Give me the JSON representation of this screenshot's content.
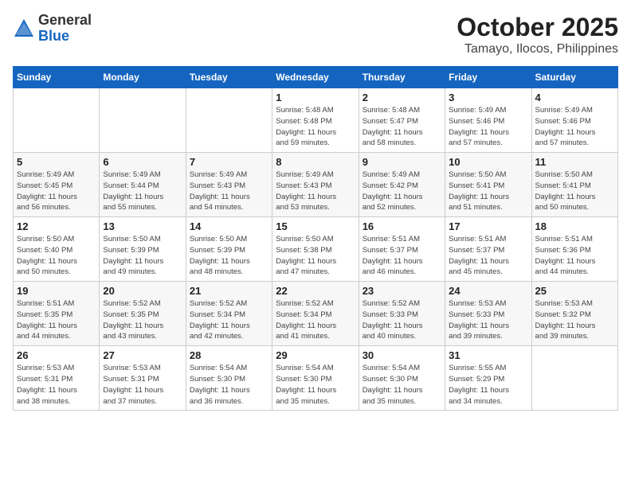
{
  "header": {
    "logo_general": "General",
    "logo_blue": "Blue",
    "month": "October 2025",
    "location": "Tamayo, Ilocos, Philippines"
  },
  "days_of_week": [
    "Sunday",
    "Monday",
    "Tuesday",
    "Wednesday",
    "Thursday",
    "Friday",
    "Saturday"
  ],
  "weeks": [
    [
      {
        "day": "",
        "info": ""
      },
      {
        "day": "",
        "info": ""
      },
      {
        "day": "",
        "info": ""
      },
      {
        "day": "1",
        "info": "Sunrise: 5:48 AM\nSunset: 5:48 PM\nDaylight: 11 hours\nand 59 minutes."
      },
      {
        "day": "2",
        "info": "Sunrise: 5:48 AM\nSunset: 5:47 PM\nDaylight: 11 hours\nand 58 minutes."
      },
      {
        "day": "3",
        "info": "Sunrise: 5:49 AM\nSunset: 5:46 PM\nDaylight: 11 hours\nand 57 minutes."
      },
      {
        "day": "4",
        "info": "Sunrise: 5:49 AM\nSunset: 5:46 PM\nDaylight: 11 hours\nand 57 minutes."
      }
    ],
    [
      {
        "day": "5",
        "info": "Sunrise: 5:49 AM\nSunset: 5:45 PM\nDaylight: 11 hours\nand 56 minutes."
      },
      {
        "day": "6",
        "info": "Sunrise: 5:49 AM\nSunset: 5:44 PM\nDaylight: 11 hours\nand 55 minutes."
      },
      {
        "day": "7",
        "info": "Sunrise: 5:49 AM\nSunset: 5:43 PM\nDaylight: 11 hours\nand 54 minutes."
      },
      {
        "day": "8",
        "info": "Sunrise: 5:49 AM\nSunset: 5:43 PM\nDaylight: 11 hours\nand 53 minutes."
      },
      {
        "day": "9",
        "info": "Sunrise: 5:49 AM\nSunset: 5:42 PM\nDaylight: 11 hours\nand 52 minutes."
      },
      {
        "day": "10",
        "info": "Sunrise: 5:50 AM\nSunset: 5:41 PM\nDaylight: 11 hours\nand 51 minutes."
      },
      {
        "day": "11",
        "info": "Sunrise: 5:50 AM\nSunset: 5:41 PM\nDaylight: 11 hours\nand 50 minutes."
      }
    ],
    [
      {
        "day": "12",
        "info": "Sunrise: 5:50 AM\nSunset: 5:40 PM\nDaylight: 11 hours\nand 50 minutes."
      },
      {
        "day": "13",
        "info": "Sunrise: 5:50 AM\nSunset: 5:39 PM\nDaylight: 11 hours\nand 49 minutes."
      },
      {
        "day": "14",
        "info": "Sunrise: 5:50 AM\nSunset: 5:39 PM\nDaylight: 11 hours\nand 48 minutes."
      },
      {
        "day": "15",
        "info": "Sunrise: 5:50 AM\nSunset: 5:38 PM\nDaylight: 11 hours\nand 47 minutes."
      },
      {
        "day": "16",
        "info": "Sunrise: 5:51 AM\nSunset: 5:37 PM\nDaylight: 11 hours\nand 46 minutes."
      },
      {
        "day": "17",
        "info": "Sunrise: 5:51 AM\nSunset: 5:37 PM\nDaylight: 11 hours\nand 45 minutes."
      },
      {
        "day": "18",
        "info": "Sunrise: 5:51 AM\nSunset: 5:36 PM\nDaylight: 11 hours\nand 44 minutes."
      }
    ],
    [
      {
        "day": "19",
        "info": "Sunrise: 5:51 AM\nSunset: 5:35 PM\nDaylight: 11 hours\nand 44 minutes."
      },
      {
        "day": "20",
        "info": "Sunrise: 5:52 AM\nSunset: 5:35 PM\nDaylight: 11 hours\nand 43 minutes."
      },
      {
        "day": "21",
        "info": "Sunrise: 5:52 AM\nSunset: 5:34 PM\nDaylight: 11 hours\nand 42 minutes."
      },
      {
        "day": "22",
        "info": "Sunrise: 5:52 AM\nSunset: 5:34 PM\nDaylight: 11 hours\nand 41 minutes."
      },
      {
        "day": "23",
        "info": "Sunrise: 5:52 AM\nSunset: 5:33 PM\nDaylight: 11 hours\nand 40 minutes."
      },
      {
        "day": "24",
        "info": "Sunrise: 5:53 AM\nSunset: 5:33 PM\nDaylight: 11 hours\nand 39 minutes."
      },
      {
        "day": "25",
        "info": "Sunrise: 5:53 AM\nSunset: 5:32 PM\nDaylight: 11 hours\nand 39 minutes."
      }
    ],
    [
      {
        "day": "26",
        "info": "Sunrise: 5:53 AM\nSunset: 5:31 PM\nDaylight: 11 hours\nand 38 minutes."
      },
      {
        "day": "27",
        "info": "Sunrise: 5:53 AM\nSunset: 5:31 PM\nDaylight: 11 hours\nand 37 minutes."
      },
      {
        "day": "28",
        "info": "Sunrise: 5:54 AM\nSunset: 5:30 PM\nDaylight: 11 hours\nand 36 minutes."
      },
      {
        "day": "29",
        "info": "Sunrise: 5:54 AM\nSunset: 5:30 PM\nDaylight: 11 hours\nand 35 minutes."
      },
      {
        "day": "30",
        "info": "Sunrise: 5:54 AM\nSunset: 5:30 PM\nDaylight: 11 hours\nand 35 minutes."
      },
      {
        "day": "31",
        "info": "Sunrise: 5:55 AM\nSunset: 5:29 PM\nDaylight: 11 hours\nand 34 minutes."
      },
      {
        "day": "",
        "info": ""
      }
    ]
  ]
}
